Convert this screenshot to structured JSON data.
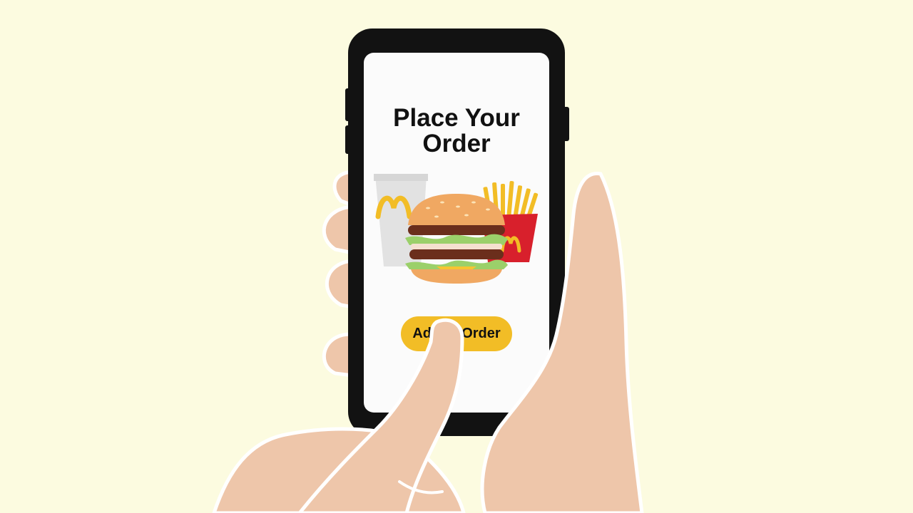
{
  "screen": {
    "title_line1": "Place Your",
    "title_line2": "Order",
    "button_label": "Add to Order"
  },
  "colors": {
    "background": "#fcfbe0",
    "phone_body": "#121212",
    "screen": "#fbfbfb",
    "button": "#f2bd26",
    "skin": "#eec6aa",
    "fries_box": "#d8202c",
    "arches": "#f2bd26"
  },
  "icons": [
    "phone",
    "drink-cup-icon",
    "burger-icon",
    "fries-icon",
    "hand"
  ]
}
